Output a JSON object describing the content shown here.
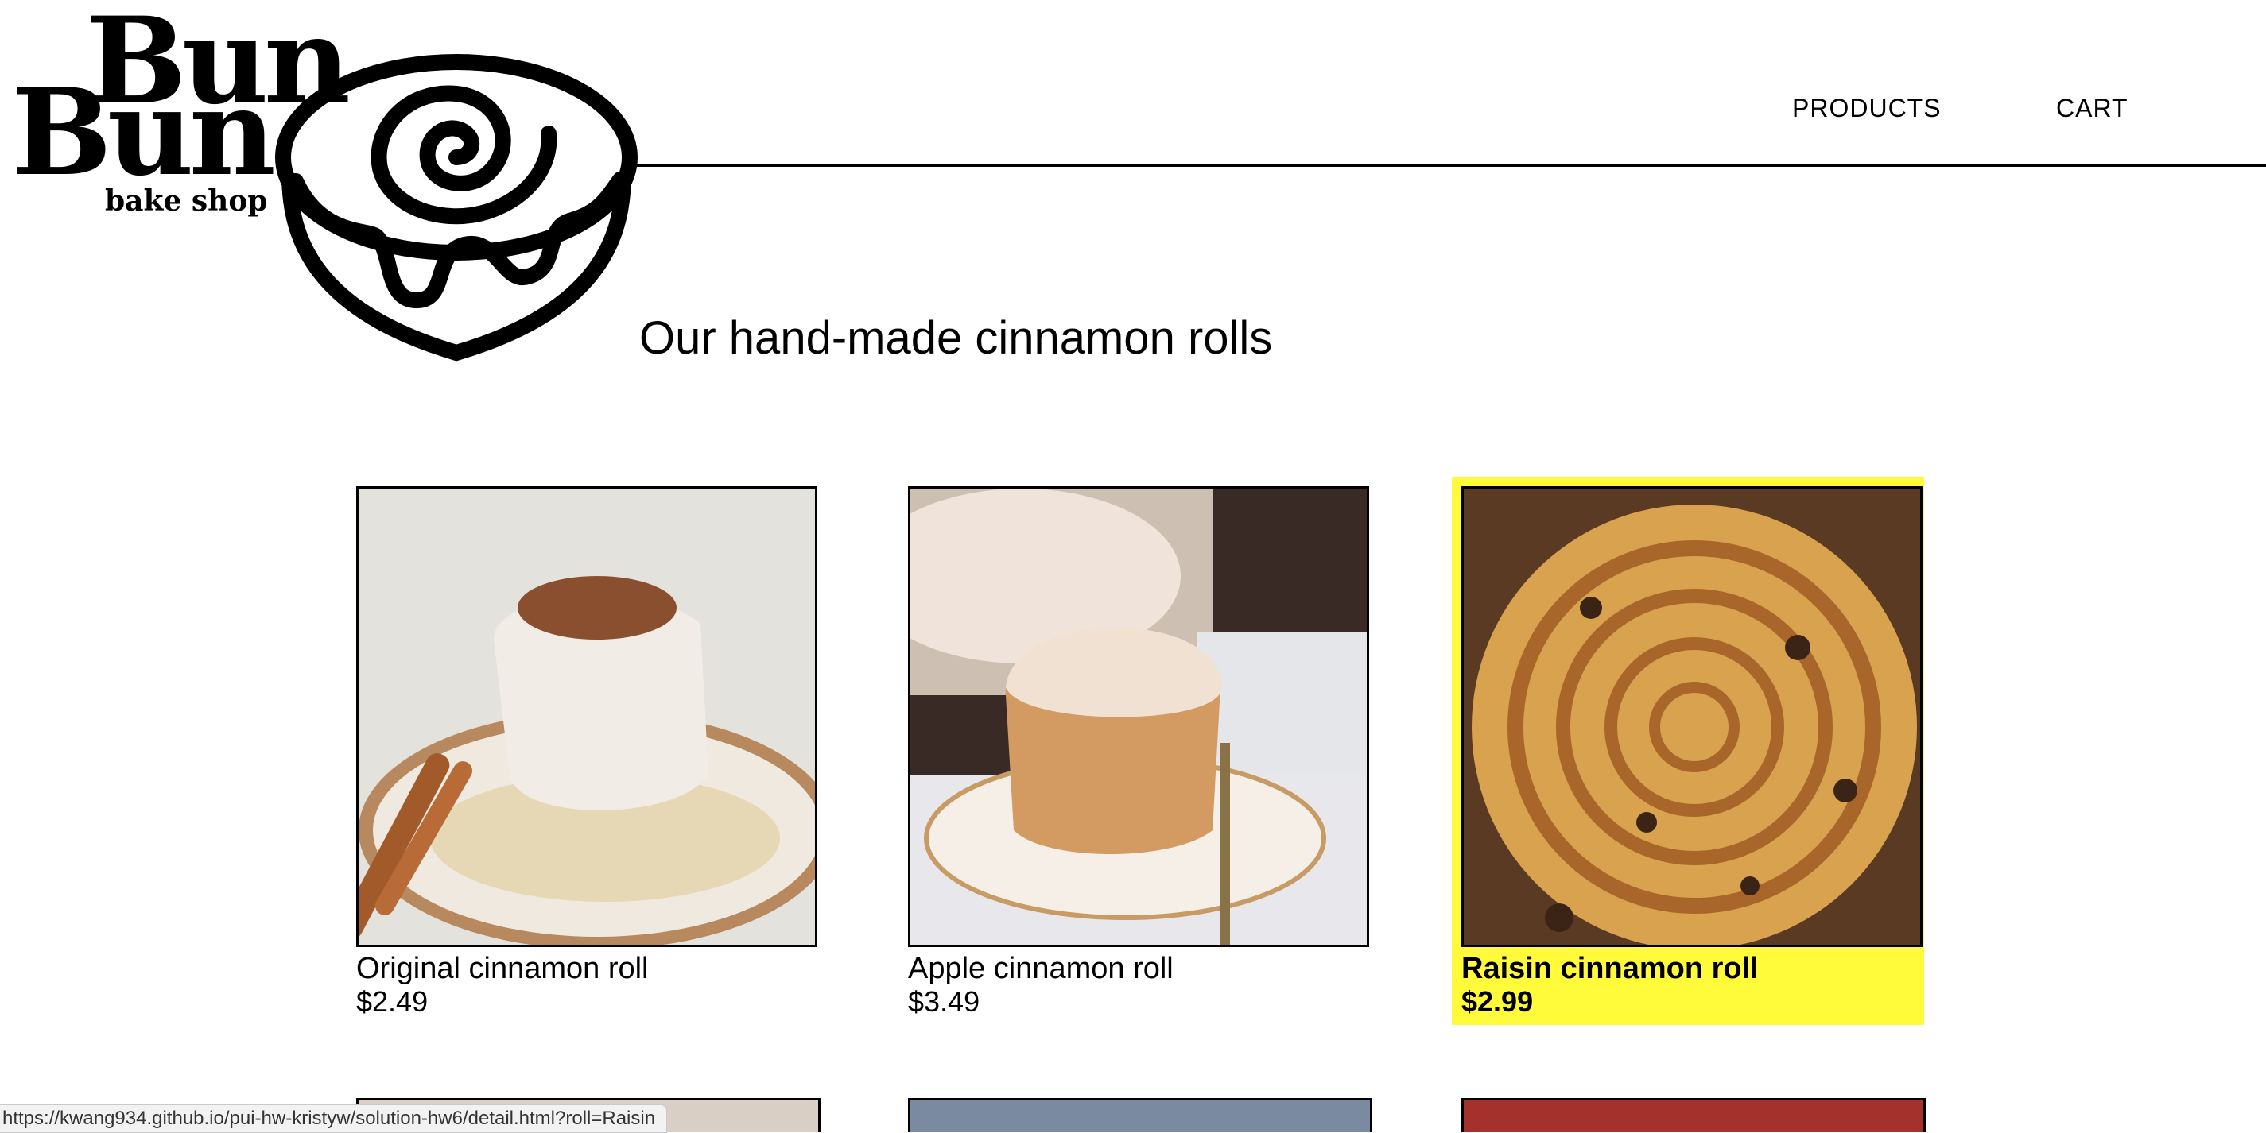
{
  "brand": {
    "word1": "Bun",
    "word2": "Bun",
    "tagline": "bake shop"
  },
  "nav": {
    "products": "PRODUCTS",
    "cart": "CART"
  },
  "page": {
    "title": "Our hand-made cinnamon rolls"
  },
  "products": [
    {
      "name": "Original cinnamon roll",
      "price": "$2.49"
    },
    {
      "name": "Apple cinnamon roll",
      "price": "$3.49"
    },
    {
      "name": "Raisin cinnamon roll",
      "price": "$2.99"
    }
  ],
  "status_bar": {
    "url": "https://kwang934.github.io/pui-hw-kristyw/solution-hw6/detail.html?roll=Raisin"
  },
  "colors": {
    "highlight": "#fffa3a",
    "text": "#000000",
    "background": "#ffffff"
  }
}
